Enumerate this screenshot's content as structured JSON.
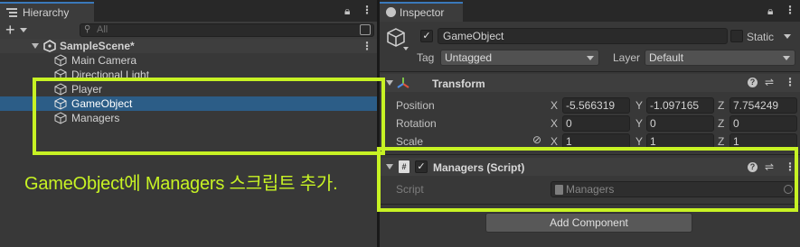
{
  "hierarchy": {
    "tab_label": "Hierarchy",
    "search_placeholder": "All",
    "scene_name": "SampleScene*",
    "items": [
      {
        "label": "Main Camera"
      },
      {
        "label": "Directional Light"
      },
      {
        "label": "Player"
      },
      {
        "label": "GameObject",
        "selected": true
      },
      {
        "label": "Managers"
      }
    ]
  },
  "inspector": {
    "tab_label": "Inspector",
    "object_name": "GameObject",
    "static_label": "Static",
    "tag_label": "Tag",
    "tag_value": "Untagged",
    "layer_label": "Layer",
    "layer_value": "Default",
    "transform": {
      "title": "Transform",
      "position_label": "Position",
      "rotation_label": "Rotation",
      "scale_label": "Scale",
      "position": {
        "x": "-5.566319",
        "y": "-1.097165",
        "z": "7.754249"
      },
      "rotation": {
        "x": "0",
        "y": "0",
        "z": "0"
      },
      "scale": {
        "x": "1",
        "y": "1",
        "z": "1"
      }
    },
    "axis_labels": {
      "x": "X",
      "y": "Y",
      "z": "Z"
    },
    "script_component": {
      "title": "Managers (Script)",
      "script_label": "Script",
      "script_value": "Managers"
    },
    "add_component_label": "Add Component"
  },
  "annotation": {
    "caption": "GameObject에 Managers 스크립트 추가.",
    "color": "#c7f224"
  },
  "colors": {
    "panel_bg": "#383838",
    "selection": "#2c5d87",
    "tab_accent": "#3a79bb"
  }
}
